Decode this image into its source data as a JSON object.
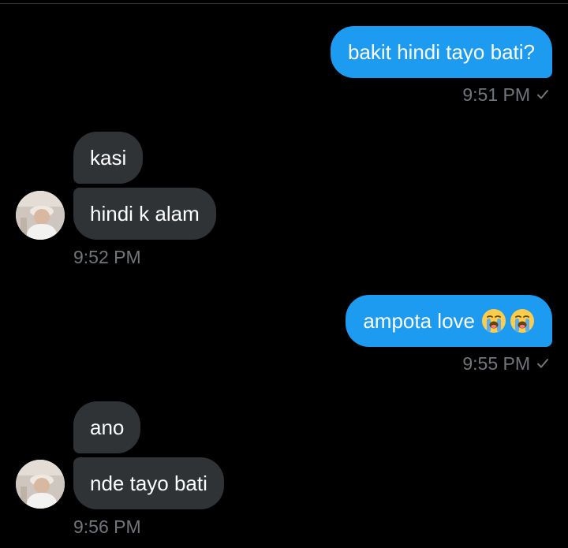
{
  "messages": [
    {
      "side": "sent",
      "text": "bakit hindi tayo bati?",
      "time": "9:51 PM"
    },
    {
      "side": "recv",
      "texts": [
        "kasi",
        "hindi k alam"
      ],
      "time": "9:52 PM"
    },
    {
      "side": "sent",
      "text": "ampota love",
      "emojis": [
        "loudly-crying-face",
        "loudly-crying-face"
      ],
      "time": "9:55 PM"
    },
    {
      "side": "recv",
      "texts": [
        "ano",
        "nde tayo bati"
      ],
      "time": "9:56 PM"
    }
  ],
  "colors": {
    "background": "#000000",
    "sent_bubble": "#1d9bf0",
    "received_bubble": "#2f3336",
    "timestamp": "#71767b"
  }
}
